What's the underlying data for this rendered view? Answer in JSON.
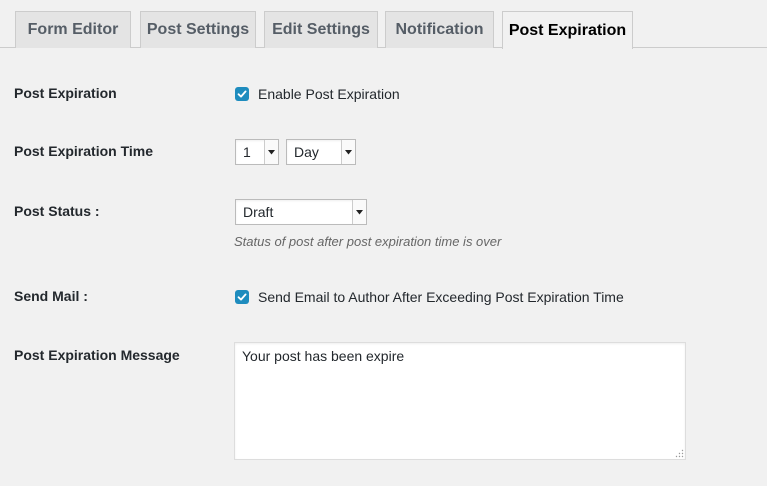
{
  "tabs": [
    {
      "label": "Form Editor",
      "active": false
    },
    {
      "label": "Post Settings",
      "active": false
    },
    {
      "label": "Edit Settings",
      "active": false
    },
    {
      "label": "Notification",
      "active": false
    },
    {
      "label": "Post Expiration",
      "active": true
    }
  ],
  "fields": {
    "post_expiration": {
      "label": "Post Expiration",
      "checkbox_label": "Enable Post Expiration",
      "checked": true
    },
    "expiration_time": {
      "label": "Post Expiration Time",
      "amount": "1",
      "unit": "Day"
    },
    "post_status": {
      "label": "Post Status :",
      "value": "Draft",
      "description": "Status of post after post expiration time is over"
    },
    "send_mail": {
      "label": "Send Mail :",
      "checkbox_label": "Send Email to Author After Exceeding Post Expiration Time",
      "checked": true
    },
    "expiration_message": {
      "label": "Post Expiration Message",
      "value": "Your post has been expire"
    }
  },
  "icons": {
    "check": "checkmark-icon",
    "dropdown": "dropdown-arrow-icon",
    "resize": "resize-handle-icon"
  },
  "colors": {
    "checkbox": "#1e8cbe",
    "background": "#f1f1f1",
    "tab_inactive": "#e4e4e4"
  }
}
